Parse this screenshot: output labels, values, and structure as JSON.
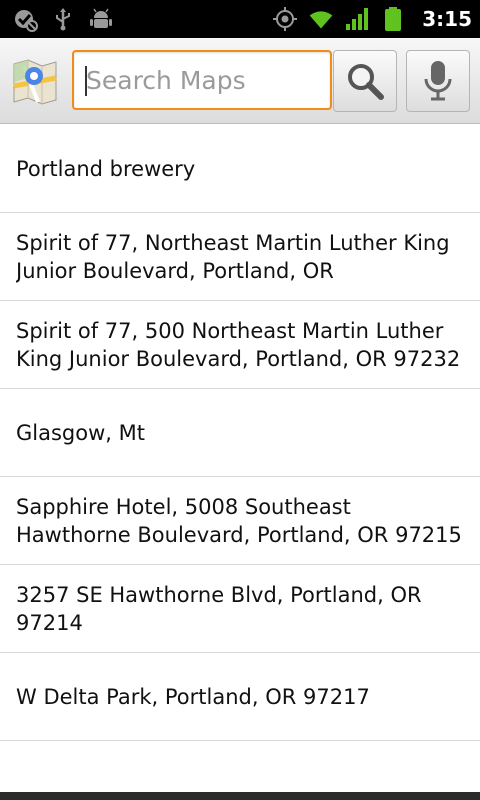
{
  "status_bar": {
    "time": "3:15",
    "left_icons": [
      "no-data-icon",
      "usb-icon",
      "android-debug-icon"
    ],
    "right_icons": [
      "gps-icon",
      "wifi-icon",
      "signal-icon",
      "battery-icon"
    ]
  },
  "header": {
    "logo_icon": "google-maps-icon",
    "search_placeholder": "Search Maps",
    "search_value": "",
    "search_button_icon": "magnifier-icon",
    "voice_button_icon": "microphone-icon",
    "accent_color": "#f08c1a"
  },
  "suggestions": [
    {
      "text": "Portland brewery"
    },
    {
      "text": "Spirit of 77, Northeast Martin Luther King Junior Boulevard, Portland, OR"
    },
    {
      "text": "Spirit of 77, 500 Northeast Martin Luther King Junior Boulevard, Portland, OR 97232"
    },
    {
      "text": "Glasgow, Mt"
    },
    {
      "text": "Sapphire Hotel, 5008 Southeast Hawthorne Boulevard, Portland, OR 97215"
    },
    {
      "text": "3257 SE Hawthorne Blvd, Portland, OR 97214"
    },
    {
      "text": "W Delta Park, Portland, OR 97217"
    }
  ]
}
